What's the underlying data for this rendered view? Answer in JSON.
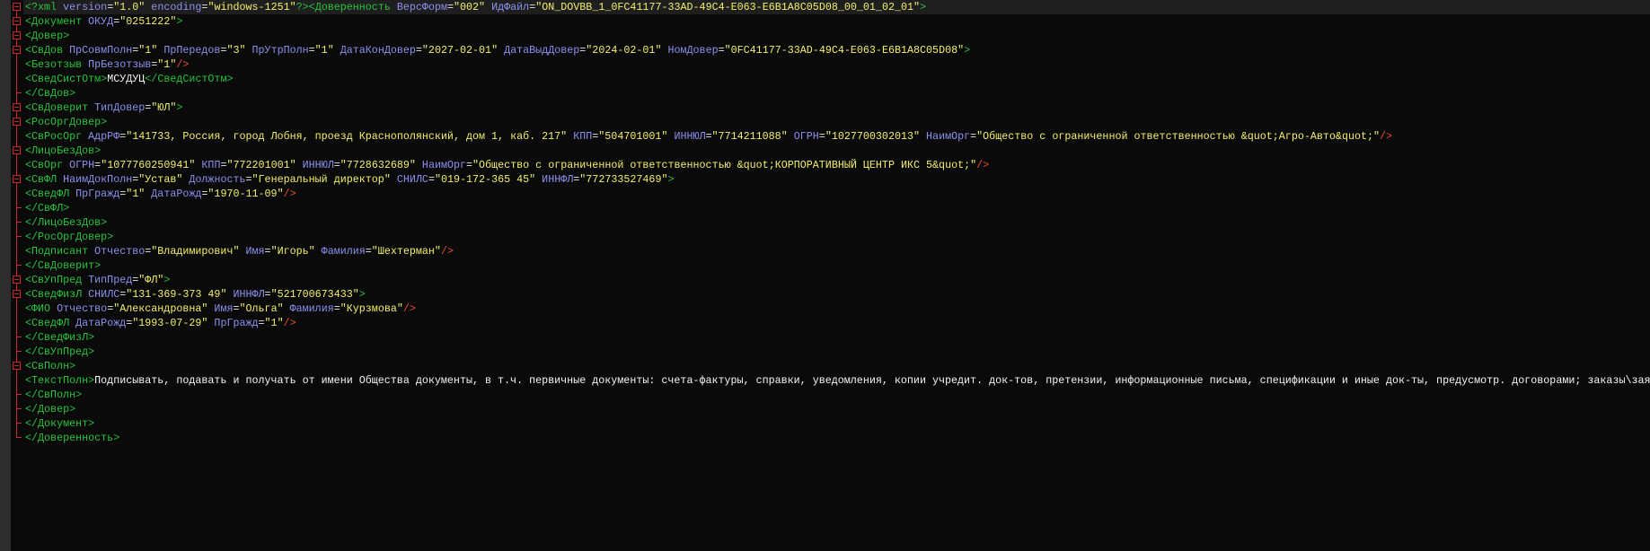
{
  "colors": {
    "background": "#0a0a0a",
    "tag": "#27c43a",
    "attribute": "#8f8ff0",
    "value": "#f0f06a",
    "text": "#f5f5f5",
    "self_close": "#ee4a33",
    "fold_marker": "#cc2a2a"
  },
  "lines": [
    [
      [
        "pi",
        "<?xml "
      ],
      [
        "attr",
        "version"
      ],
      [
        "eq",
        "="
      ],
      [
        "val",
        "\"1.0\""
      ],
      [
        "attr",
        " encoding"
      ],
      [
        "eq",
        "="
      ],
      [
        "val",
        "\"windows-1251\""
      ],
      [
        "pi",
        "?>"
      ],
      [
        "br",
        "<"
      ],
      [
        "tag",
        "Доверенность"
      ],
      [
        "attr",
        " ВерсФорм"
      ],
      [
        "eq",
        "="
      ],
      [
        "val",
        "\"002\""
      ],
      [
        "attr",
        " ИдФайл"
      ],
      [
        "eq",
        "="
      ],
      [
        "val",
        "\"ON_DOVBB_1_0FC41177-33AD-49C4-E063-E6B1A8C05D08_00_01_02_01\""
      ],
      [
        "br",
        ">"
      ]
    ],
    [
      [
        "br",
        "<"
      ],
      [
        "tag",
        "Документ"
      ],
      [
        "attr",
        " ОКУД"
      ],
      [
        "eq",
        "="
      ],
      [
        "val",
        "\"0251222\""
      ],
      [
        "br",
        ">"
      ]
    ],
    [
      [
        "br",
        "<"
      ],
      [
        "tag",
        "Довер"
      ],
      [
        "br",
        ">"
      ]
    ],
    [
      [
        "br",
        "<"
      ],
      [
        "tag",
        "СвДов"
      ],
      [
        "attr",
        " ПрСовмПолн"
      ],
      [
        "eq",
        "="
      ],
      [
        "val",
        "\"1\""
      ],
      [
        "attr",
        " ПрПередов"
      ],
      [
        "eq",
        "="
      ],
      [
        "val",
        "\"3\""
      ],
      [
        "attr",
        " ПрУтрПолн"
      ],
      [
        "eq",
        "="
      ],
      [
        "val",
        "\"1\""
      ],
      [
        "attr",
        " ДатаКонДовер"
      ],
      [
        "eq",
        "="
      ],
      [
        "val",
        "\"2027-02-01\""
      ],
      [
        "attr",
        " ДатаВыдДовер"
      ],
      [
        "eq",
        "="
      ],
      [
        "val",
        "\"2024-02-01\""
      ],
      [
        "attr",
        " НомДовер"
      ],
      [
        "eq",
        "="
      ],
      [
        "val",
        "\"0FC41177-33AD-49C4-E063-E6B1A8C05D08\""
      ],
      [
        "br",
        ">"
      ]
    ],
    [
      [
        "br",
        "<"
      ],
      [
        "tag",
        "Безотзыв"
      ],
      [
        "attr",
        " ПрБезотзыв"
      ],
      [
        "eq",
        "="
      ],
      [
        "val",
        "\"1\""
      ],
      [
        "slash",
        "/>"
      ]
    ],
    [
      [
        "br",
        "<"
      ],
      [
        "tag",
        "СведСистОтм"
      ],
      [
        "br",
        ">"
      ],
      [
        "text",
        "МСУДУЦ"
      ],
      [
        "br",
        "</"
      ],
      [
        "tag",
        "СведСистОтм"
      ],
      [
        "br",
        ">"
      ]
    ],
    [
      [
        "br",
        "</"
      ],
      [
        "tag",
        "СвДов"
      ],
      [
        "br",
        ">"
      ]
    ],
    [
      [
        "br",
        "<"
      ],
      [
        "tag",
        "СвДоверит"
      ],
      [
        "attr",
        " ТипДовер"
      ],
      [
        "eq",
        "="
      ],
      [
        "val",
        "\"ЮЛ\""
      ],
      [
        "br",
        ">"
      ]
    ],
    [
      [
        "br",
        "<"
      ],
      [
        "tag",
        "РосОргДовер"
      ],
      [
        "br",
        ">"
      ]
    ],
    [
      [
        "br",
        "<"
      ],
      [
        "tag",
        "СвРосОрг"
      ],
      [
        "attr",
        " АдрРФ"
      ],
      [
        "eq",
        "="
      ],
      [
        "val",
        "\"141733, Россия, город Лобня, проезд Краснополянский, дом 1, каб. 217\""
      ],
      [
        "attr",
        " КПП"
      ],
      [
        "eq",
        "="
      ],
      [
        "val",
        "\"504701001\""
      ],
      [
        "attr",
        " ИННЮЛ"
      ],
      [
        "eq",
        "="
      ],
      [
        "val",
        "\"7714211088\""
      ],
      [
        "attr",
        " ОГРН"
      ],
      [
        "eq",
        "="
      ],
      [
        "val",
        "\"1027700302013\""
      ],
      [
        "attr",
        " НаимОрг"
      ],
      [
        "eq",
        "="
      ],
      [
        "val",
        "\"Общество с ограниченной ответственностью &quot;Агро-Авто&quot;\""
      ],
      [
        "slash",
        "/>"
      ]
    ],
    [
      [
        "br",
        "<"
      ],
      [
        "tag",
        "ЛицоБезДов"
      ],
      [
        "br",
        ">"
      ]
    ],
    [
      [
        "br",
        "<"
      ],
      [
        "tag",
        "СвОрг"
      ],
      [
        "attr",
        " ОГРН"
      ],
      [
        "eq",
        "="
      ],
      [
        "val",
        "\"1077760250941\""
      ],
      [
        "attr",
        " КПП"
      ],
      [
        "eq",
        "="
      ],
      [
        "val",
        "\"772201001\""
      ],
      [
        "attr",
        " ИННЮЛ"
      ],
      [
        "eq",
        "="
      ],
      [
        "val",
        "\"7728632689\""
      ],
      [
        "attr",
        " НаимОрг"
      ],
      [
        "eq",
        "="
      ],
      [
        "val",
        "\"Общество с ограниченной ответственностью &quot;КОРПОРАТИВНЫЙ ЦЕНТР ИКС 5&quot;\""
      ],
      [
        "slash",
        "/>"
      ]
    ],
    [
      [
        "br",
        "<"
      ],
      [
        "tag",
        "СвФЛ"
      ],
      [
        "attr",
        " НаимДокПолн"
      ],
      [
        "eq",
        "="
      ],
      [
        "val",
        "\"Устав\""
      ],
      [
        "attr",
        " Должность"
      ],
      [
        "eq",
        "="
      ],
      [
        "val",
        "\"Генеральный директор\""
      ],
      [
        "attr",
        " СНИЛС"
      ],
      [
        "eq",
        "="
      ],
      [
        "val",
        "\"019-172-365 45\""
      ],
      [
        "attr",
        " ИННФЛ"
      ],
      [
        "eq",
        "="
      ],
      [
        "val",
        "\"772733527469\""
      ],
      [
        "br",
        ">"
      ]
    ],
    [
      [
        "br",
        "<"
      ],
      [
        "tag",
        "СведФЛ"
      ],
      [
        "attr",
        " ПрГражд"
      ],
      [
        "eq",
        "="
      ],
      [
        "val",
        "\"1\""
      ],
      [
        "attr",
        " ДатаРожд"
      ],
      [
        "eq",
        "="
      ],
      [
        "val",
        "\"1970-11-09\""
      ],
      [
        "slash",
        "/>"
      ]
    ],
    [
      [
        "br",
        "</"
      ],
      [
        "tag",
        "СвФЛ"
      ],
      [
        "br",
        ">"
      ]
    ],
    [
      [
        "br",
        "</"
      ],
      [
        "tag",
        "ЛицоБезДов"
      ],
      [
        "br",
        ">"
      ]
    ],
    [
      [
        "br",
        "</"
      ],
      [
        "tag",
        "РосОргДовер"
      ],
      [
        "br",
        ">"
      ]
    ],
    [
      [
        "br",
        "<"
      ],
      [
        "tag",
        "Подписант"
      ],
      [
        "attr",
        " Отчество"
      ],
      [
        "eq",
        "="
      ],
      [
        "val",
        "\"Владимирович\""
      ],
      [
        "attr",
        " Имя"
      ],
      [
        "eq",
        "="
      ],
      [
        "val",
        "\"Игорь\""
      ],
      [
        "attr",
        " Фамилия"
      ],
      [
        "eq",
        "="
      ],
      [
        "val",
        "\"Шехтерман\""
      ],
      [
        "slash",
        "/>"
      ]
    ],
    [
      [
        "br",
        "</"
      ],
      [
        "tag",
        "СвДоверит"
      ],
      [
        "br",
        ">"
      ]
    ],
    [
      [
        "br",
        "<"
      ],
      [
        "tag",
        "СвУпПред"
      ],
      [
        "attr",
        " ТипПред"
      ],
      [
        "eq",
        "="
      ],
      [
        "val",
        "\"ФЛ\""
      ],
      [
        "br",
        ">"
      ]
    ],
    [
      [
        "br",
        "<"
      ],
      [
        "tag",
        "СведФизЛ"
      ],
      [
        "attr",
        " СНИЛС"
      ],
      [
        "eq",
        "="
      ],
      [
        "val",
        "\"131-369-373 49\""
      ],
      [
        "attr",
        " ИННФЛ"
      ],
      [
        "eq",
        "="
      ],
      [
        "val",
        "\"521700673433\""
      ],
      [
        "br",
        ">"
      ]
    ],
    [
      [
        "br",
        "<"
      ],
      [
        "tag",
        "ФИО"
      ],
      [
        "attr",
        " Отчество"
      ],
      [
        "eq",
        "="
      ],
      [
        "val",
        "\"Александровна\""
      ],
      [
        "attr",
        " Имя"
      ],
      [
        "eq",
        "="
      ],
      [
        "val",
        "\"Ольга\""
      ],
      [
        "attr",
        " Фамилия"
      ],
      [
        "eq",
        "="
      ],
      [
        "val",
        "\"Курзмова\""
      ],
      [
        "slash",
        "/>"
      ]
    ],
    [
      [
        "br",
        "<"
      ],
      [
        "tag",
        "СведФЛ"
      ],
      [
        "attr",
        " ДатаРожд"
      ],
      [
        "eq",
        "="
      ],
      [
        "val",
        "\"1993-07-29\""
      ],
      [
        "attr",
        " ПрГражд"
      ],
      [
        "eq",
        "="
      ],
      [
        "val",
        "\"1\""
      ],
      [
        "slash",
        "/>"
      ]
    ],
    [
      [
        "br",
        "</"
      ],
      [
        "tag",
        "СведФизЛ"
      ],
      [
        "br",
        ">"
      ]
    ],
    [
      [
        "br",
        "</"
      ],
      [
        "tag",
        "СвУпПред"
      ],
      [
        "br",
        ">"
      ]
    ],
    [
      [
        "br",
        "<"
      ],
      [
        "tag",
        "СвПолн"
      ],
      [
        "br",
        ">"
      ]
    ],
    [
      [
        "br",
        "<"
      ],
      [
        "tag",
        "ТекстПолн"
      ],
      [
        "br",
        ">"
      ],
      [
        "text",
        "Подписывать, подавать и получать от имени Общества документы, в т.ч. первичные документы: счета-фактуры, справки, уведомления, копии учредит. док-тов, претензии, информационные письма, спецификации и иные док-ты, предусмотр. договорами; заказы\\заяв"
      ]
    ],
    [
      [
        "br",
        "</"
      ],
      [
        "tag",
        "СвПолн"
      ],
      [
        "br",
        ">"
      ]
    ],
    [
      [
        "br",
        "</"
      ],
      [
        "tag",
        "Довер"
      ],
      [
        "br",
        ">"
      ]
    ],
    [
      [
        "br",
        "</"
      ],
      [
        "tag",
        "Документ"
      ],
      [
        "br",
        ">"
      ]
    ],
    [
      [
        "br",
        "</"
      ],
      [
        "tag",
        "Доверенность"
      ],
      [
        "br",
        ">"
      ]
    ]
  ],
  "fold_open_lines": [
    0,
    1,
    2,
    3,
    7,
    8,
    10,
    12,
    19,
    20,
    25
  ],
  "fold_close_lines": [
    6,
    14,
    15,
    16,
    18,
    23,
    24,
    27,
    28,
    29,
    30
  ]
}
